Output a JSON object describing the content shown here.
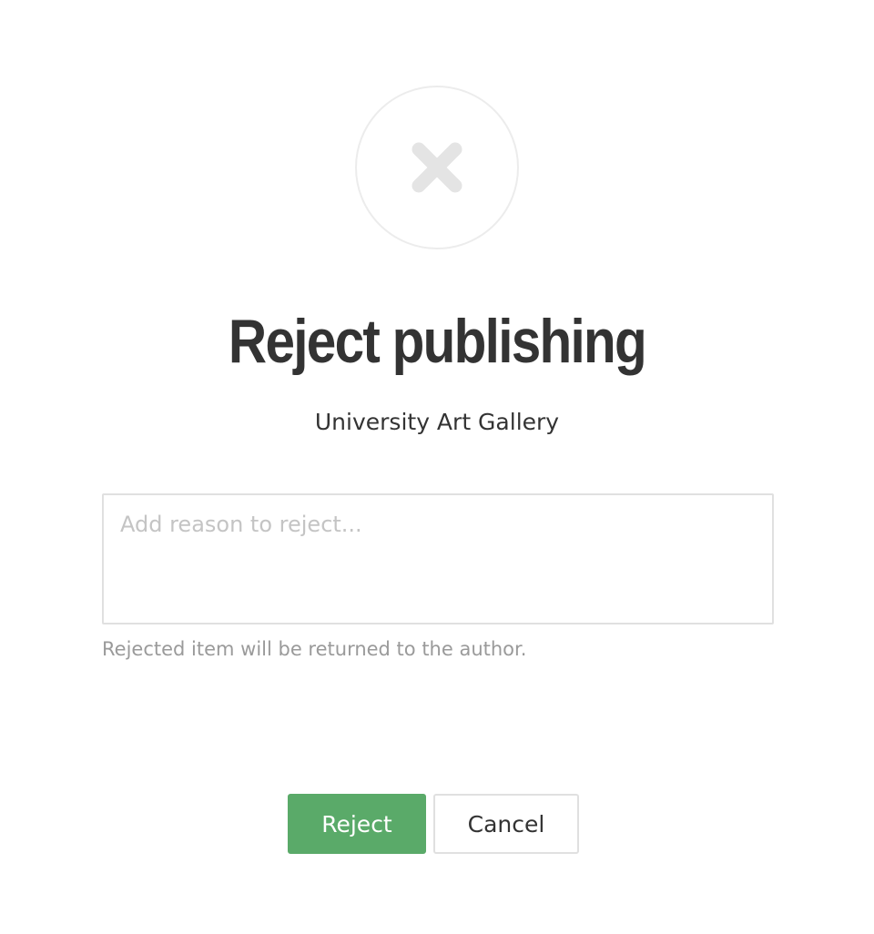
{
  "dialog": {
    "icon": "close-x-icon",
    "title": "Reject publishing",
    "subtitle": "University Art Gallery",
    "reason_input": {
      "value": "",
      "placeholder": "Add reason to reject..."
    },
    "hint": "Rejected item will be returned to the author.",
    "actions": {
      "reject_label": "Reject",
      "cancel_label": "Cancel"
    }
  },
  "colors": {
    "primary": "#5aaa69",
    "title_text": "#333333",
    "hint_text": "#9a9a9a",
    "placeholder_text": "#c4c4c4",
    "icon": "#e4e4e4",
    "border": "#e0e0e0"
  }
}
